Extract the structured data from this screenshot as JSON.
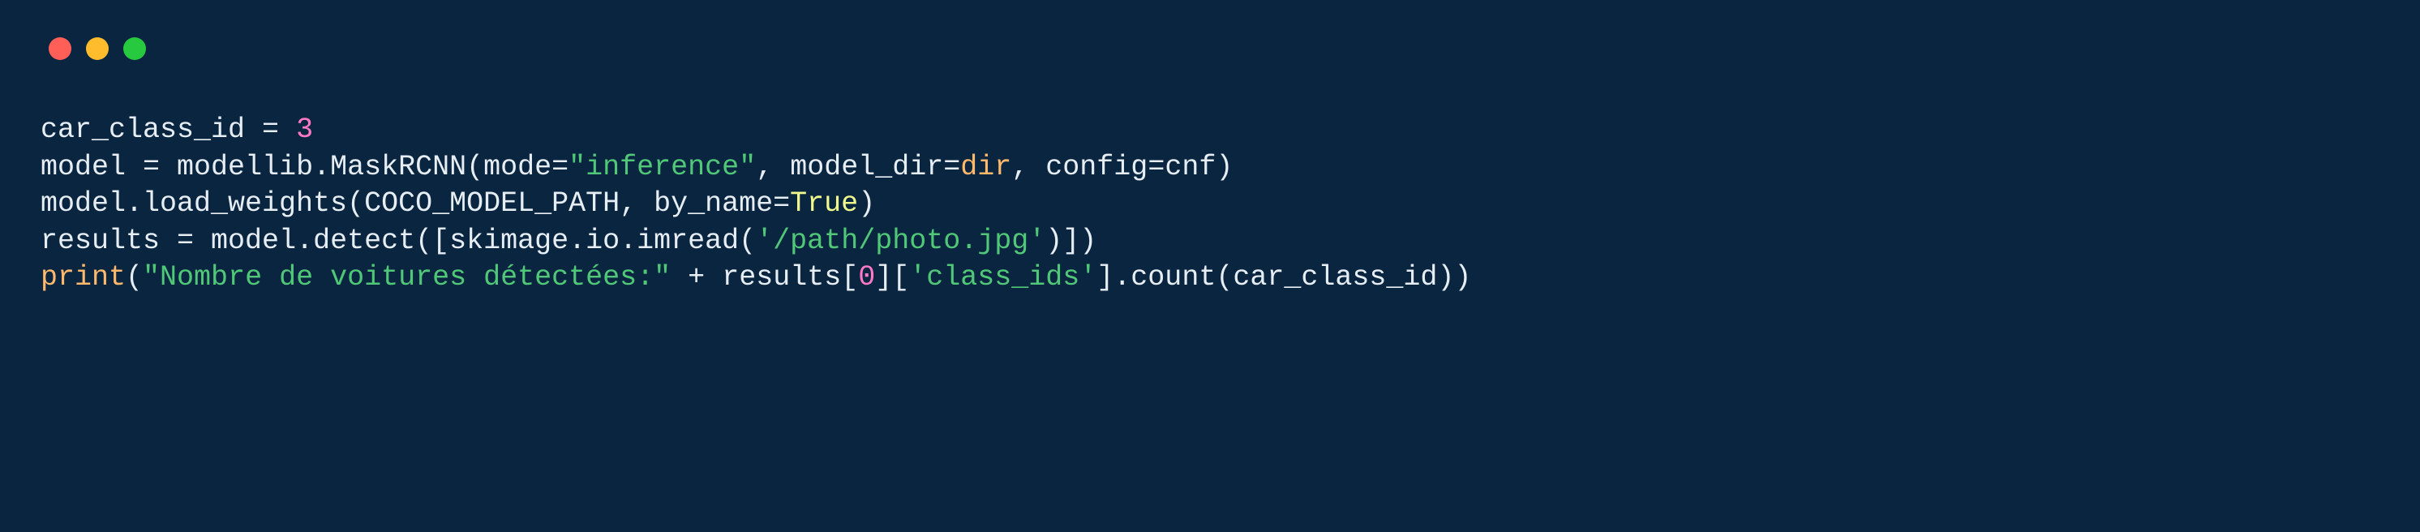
{
  "window": {
    "traffic_lights": [
      "red",
      "yellow",
      "green"
    ]
  },
  "code": {
    "lines": [
      {
        "tokens": [
          {
            "t": "car_class_id ",
            "c": "tok-default"
          },
          {
            "t": "=",
            "c": "tok-punc"
          },
          {
            "t": " ",
            "c": "tok-default"
          },
          {
            "t": "3",
            "c": "tok-number"
          }
        ]
      },
      {
        "tokens": [
          {
            "t": "model ",
            "c": "tok-default"
          },
          {
            "t": "=",
            "c": "tok-punc"
          },
          {
            "t": " modellib.MaskRCNN(mode",
            "c": "tok-default"
          },
          {
            "t": "=",
            "c": "tok-punc"
          },
          {
            "t": "\"inference\"",
            "c": "tok-string"
          },
          {
            "t": ", model_dir",
            "c": "tok-default"
          },
          {
            "t": "=",
            "c": "tok-punc"
          },
          {
            "t": "dir",
            "c": "tok-const"
          },
          {
            "t": ", config",
            "c": "tok-default"
          },
          {
            "t": "=",
            "c": "tok-punc"
          },
          {
            "t": "cnf)",
            "c": "tok-default"
          }
        ]
      },
      {
        "tokens": [
          {
            "t": "model.load_weights(COCO_MODEL_PATH, by_name",
            "c": "tok-default"
          },
          {
            "t": "=",
            "c": "tok-punc"
          },
          {
            "t": "True",
            "c": "tok-bool"
          },
          {
            "t": ")",
            "c": "tok-default"
          }
        ]
      },
      {
        "tokens": [
          {
            "t": "results ",
            "c": "tok-default"
          },
          {
            "t": "=",
            "c": "tok-punc"
          },
          {
            "t": " model.detect([skimage.io.imread(",
            "c": "tok-default"
          },
          {
            "t": "'/path/photo.jpg'",
            "c": "tok-string"
          },
          {
            "t": ")])",
            "c": "tok-default"
          }
        ]
      },
      {
        "tokens": [
          {
            "t": "print",
            "c": "tok-const"
          },
          {
            "t": "(",
            "c": "tok-default"
          },
          {
            "t": "\"Nombre de voitures détectées:\"",
            "c": "tok-string"
          },
          {
            "t": " ",
            "c": "tok-default"
          },
          {
            "t": "+",
            "c": "tok-punc"
          },
          {
            "t": " results[",
            "c": "tok-default"
          },
          {
            "t": "0",
            "c": "tok-zero"
          },
          {
            "t": "][",
            "c": "tok-default"
          },
          {
            "t": "'class_ids'",
            "c": "tok-string"
          },
          {
            "t": "].count(car_class_id))",
            "c": "tok-default"
          }
        ]
      }
    ]
  }
}
